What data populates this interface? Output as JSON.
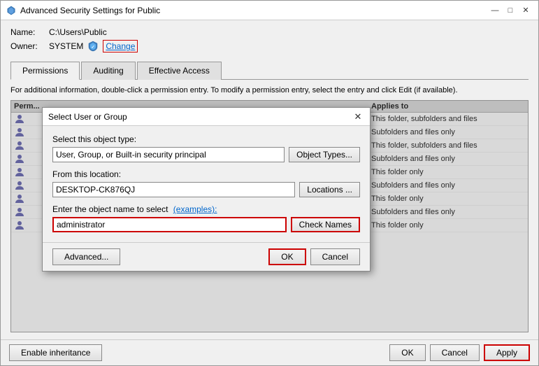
{
  "window": {
    "title": "Advanced Security Settings for Public",
    "icon": "shield-icon"
  },
  "title_controls": {
    "minimize": "—",
    "maximize": "□",
    "close": "✕"
  },
  "fields": {
    "name_label": "Name:",
    "name_value": "C:\\Users\\Public",
    "owner_label": "Owner:",
    "owner_value": "SYSTEM",
    "change_label": "Change"
  },
  "tabs": [
    {
      "id": "permissions",
      "label": "Permissions",
      "active": false
    },
    {
      "id": "auditing",
      "label": "Auditing",
      "active": false
    },
    {
      "id": "effective-access",
      "label": "Effective Access",
      "active": false
    }
  ],
  "info_text": "For additional information, double-click a permission entry. To modify a permission entry, select the entry and click Edit (if available).",
  "table": {
    "headers": [
      "Permission entries:",
      "Applies to"
    ],
    "col_perm": "Perm...",
    "rows": [
      {
        "icon": "user",
        "applies": "This folder, subfolders and files"
      },
      {
        "icon": "user",
        "applies": "Subfolders and files only"
      },
      {
        "icon": "user",
        "applies": "This folder, subfolders and files"
      },
      {
        "icon": "user",
        "applies": "Subfolders and files only"
      },
      {
        "icon": "user",
        "applies": "This folder only"
      },
      {
        "icon": "user",
        "applies": "Subfolders and files only"
      },
      {
        "icon": "user",
        "applies": "This folder only"
      },
      {
        "icon": "user",
        "applies": "Subfolders and files only"
      },
      {
        "icon": "user",
        "applies": "This folder only"
      }
    ]
  },
  "dialog": {
    "title": "Select User or Group",
    "object_type_label": "Select this object type:",
    "object_type_value": "User, Group, or Built-in security principal",
    "object_types_btn": "Object Types...",
    "from_location_label": "From this location:",
    "from_location_value": "DESKTOP-CK876QJ",
    "locations_btn": "Locations ...",
    "object_name_label": "Enter the object name to select",
    "examples_link": "(examples):",
    "object_name_value": "administrator",
    "check_names_btn": "Check Names",
    "advanced_btn": "Advanced...",
    "ok_btn": "OK",
    "cancel_btn": "Cancel"
  },
  "bottom": {
    "enable_inheritance_btn": "Enable inheritance",
    "ok_btn": "OK",
    "cancel_btn": "Cancel",
    "apply_btn": "Apply"
  },
  "colors": {
    "accent_red": "#cc0000",
    "link_blue": "#0066cc",
    "user_icon_blue": "#5555aa"
  }
}
